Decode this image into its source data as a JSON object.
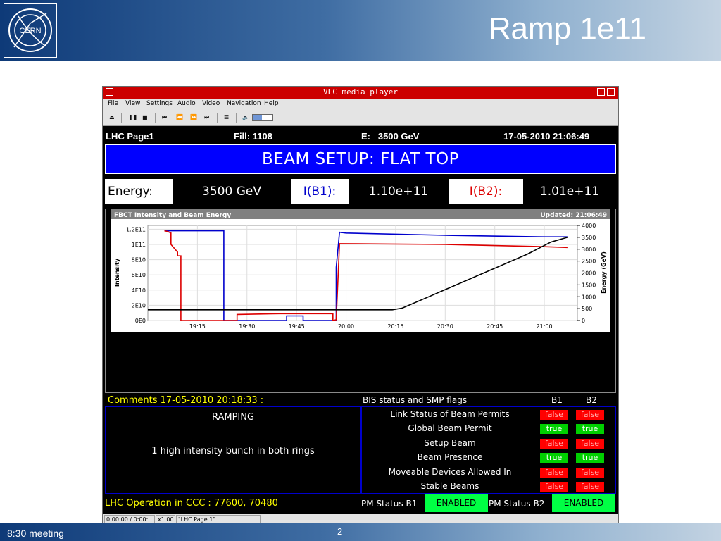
{
  "slide": {
    "title": "Ramp 1e11",
    "logo_text": "CERN",
    "footer_left": "8:30 meeting",
    "page_number": "2",
    "colors": {
      "header_dark": "#0e3a78",
      "header_light": "#c3d3e2"
    }
  },
  "vlc": {
    "window_title": "VLC media player",
    "menu": [
      {
        "key": "F",
        "rest": "ile"
      },
      {
        "key": "V",
        "rest": "iew"
      },
      {
        "key": "S",
        "rest": "ettings"
      },
      {
        "key": "A",
        "rest": "udio"
      },
      {
        "key": "V",
        "rest": "ideo"
      },
      {
        "key": "N",
        "rest": "avigation"
      },
      {
        "key": "H",
        "rest": "elp"
      }
    ],
    "toolbar_icons": [
      "eject-icon",
      "pause-icon",
      "stop-icon",
      "skip-back-icon",
      "rewind-icon",
      "fast-forward-icon",
      "skip-forward-icon",
      "playlist-icon",
      "volume-icon"
    ],
    "volume_level": 0.45,
    "status": {
      "time": "0:00:00 / 0:00:",
      "speed": "x1.00",
      "media": "\"LHC Page 1\""
    }
  },
  "lhc": {
    "page": "LHC Page1",
    "fill": "Fill: 1108",
    "energy_header": "E:   3500 GeV",
    "datetime": "17-05-2010 21:06:49",
    "beam_mode": "BEAM SETUP: FLAT TOP",
    "energy_label": "Energy:",
    "energy_value": "3500 GeV",
    "ib1_label": "I(B1):",
    "ib1_value": "1.10e+11",
    "ib2_label": "I(B2):",
    "ib2_value": "1.01e+11",
    "comments_header": "Comments 17-05-2010 20:18:33 :",
    "comment_status": "RAMPING",
    "comment_text": "1 high intensity bunch in both rings",
    "bis_header": "BIS status and SMP flags",
    "b1": "B1",
    "b2": "B2",
    "flags": [
      {
        "label": "Link Status of Beam Permits",
        "b1": "false",
        "b2": "false"
      },
      {
        "label": "Global Beam Permit",
        "b1": "true",
        "b2": "true"
      },
      {
        "label": "Setup Beam",
        "b1": "false",
        "b2": "false"
      },
      {
        "label": "Beam Presence",
        "b1": "true",
        "b2": "true"
      },
      {
        "label": "Moveable Devices Allowed In",
        "b1": "false",
        "b2": "false"
      },
      {
        "label": "Stable Beams",
        "b1": "false",
        "b2": "false"
      }
    ],
    "ops_line": "LHC Operation in CCC : 77600, 70480",
    "pm_b1_label": "PM Status B1",
    "pm_b1_value": "ENABLED",
    "pm_b2_label": "PM Status B2",
    "pm_b2_value": "ENABLED",
    "colors": {
      "banner": "#0000ff",
      "b1": "#0000cc",
      "b2": "#dd0000",
      "flag_false": "#ff0000",
      "flag_true": "#00d000",
      "pm_enabled": "#00ff44",
      "comments": "#ffff00"
    }
  },
  "chart_data": {
    "type": "line",
    "title": "FBCT Intensity and Beam Energy",
    "updated": "Updated: 21:06:49",
    "xlabel": "",
    "ylabel": "Intensity",
    "y2label": "Energy (GeV)",
    "x_ticks": [
      "19:15",
      "19:30",
      "19:45",
      "20:00",
      "20:15",
      "20:30",
      "20:45",
      "21:00"
    ],
    "y_ticks": [
      "0E0",
      "2E10",
      "4E10",
      "6E10",
      "8E10",
      "1E11",
      "1.2E11"
    ],
    "y2_ticks": [
      "0",
      "500",
      "1000",
      "1500",
      "2000",
      "2500",
      "3000",
      "3500",
      "4000"
    ],
    "xlim": [
      "19:00",
      "21:10"
    ],
    "ylim": [
      0,
      125000000000.0
    ],
    "y2lim": [
      0,
      4000
    ],
    "grid": true,
    "series": [
      {
        "axis": "left",
        "color": "#0000cc",
        "x": [
          "19:05",
          "19:23",
          "19:23",
          "19:30",
          "19:42",
          "19:42",
          "19:47",
          "19:47",
          "19:57",
          "19:57",
          "19:58",
          "20:00",
          "20:30",
          "21:00",
          "21:07"
        ],
        "y": [
          118000000000.0,
          118000000000.0,
          0,
          0,
          0,
          6000000000.0,
          6000000000.0,
          0,
          0,
          70000000000.0,
          116000000000.0,
          115000000000.0,
          112000000000.0,
          110000000000.0,
          110000000000.0
        ]
      },
      {
        "axis": "left",
        "color": "#dd0000",
        "x": [
          "19:05",
          "19:06",
          "19:07",
          "19:07",
          "19:09",
          "19:09",
          "19:10",
          "19:10",
          "19:24",
          "19:27",
          "19:27",
          "19:40",
          "19:49",
          "19:56",
          "19:56",
          "19:57",
          "19:58",
          "20:30",
          "21:00",
          "21:07"
        ],
        "y": [
          118000000000.0,
          117000000000.0,
          115000000000.0,
          100000000000.0,
          90000000000.0,
          85000000000.0,
          85000000000.0,
          0,
          0,
          0,
          8000000000.0,
          9000000000.0,
          9000000000.0,
          9000000000.0,
          0,
          1000000000.0,
          101000000000.0,
          100000000000.0,
          97000000000.0,
          96000000000.0
        ]
      },
      {
        "axis": "right",
        "color": "#000000",
        "x": [
          "19:00",
          "20:14",
          "20:17",
          "20:25",
          "20:35",
          "20:45",
          "20:55",
          "21:02",
          "21:07"
        ],
        "y": [
          450,
          450,
          520,
          1000,
          1600,
          2200,
          2800,
          3300,
          3500
        ]
      }
    ]
  }
}
